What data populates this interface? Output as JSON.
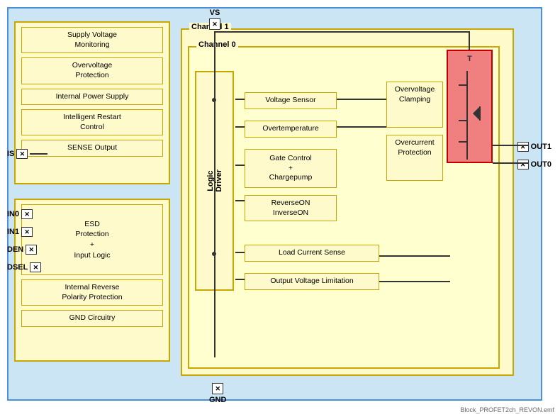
{
  "title": "Block_PROFET2ch_REVON",
  "filename": "Block_PROFET2ch_REVON.emf",
  "colors": {
    "blue_bg": "#cce5f5",
    "blue_border": "#4a90d9",
    "yellow_bg": "#fffacc",
    "yellow_border": "#c8a800",
    "red_bg": "#f08080",
    "red_border": "#c00000",
    "line": "#333333"
  },
  "pins": {
    "vs": "VS",
    "gnd": "GND",
    "is": "IS",
    "in0": "IN0",
    "in1": "IN1",
    "den": "DEN",
    "dsel": "DSEL",
    "out1": "OUT1",
    "out0": "OUT0"
  },
  "left_features": [
    "Supply Voltage\nMonitoring",
    "Overvoltage\nProtection",
    "Internal Power Supply",
    "Intelligent Restart\nControl",
    "SENSE Output"
  ],
  "left_bottom_features": [
    "ESD\nProtection\n+\nInput Logic",
    "Internal Reverse\nPolarity Protection",
    "GND Circuitry"
  ],
  "channel_labels": {
    "ch1": "Channel 1",
    "ch0": "Channel 0"
  },
  "channel_boxes": [
    "Voltage Sensor",
    "Overtemperature",
    "Gate Control\n+\nChargepump",
    "ReverseON\nInverseON",
    "Load Current Sense",
    "Output Voltage Limitation"
  ],
  "driver_logic": "Driver\nLogic",
  "overvoltage_clamping": "Overvoltage\nClamping",
  "overcurrent_protection": "Overcurrent\nProtection",
  "transistor_label": "T"
}
